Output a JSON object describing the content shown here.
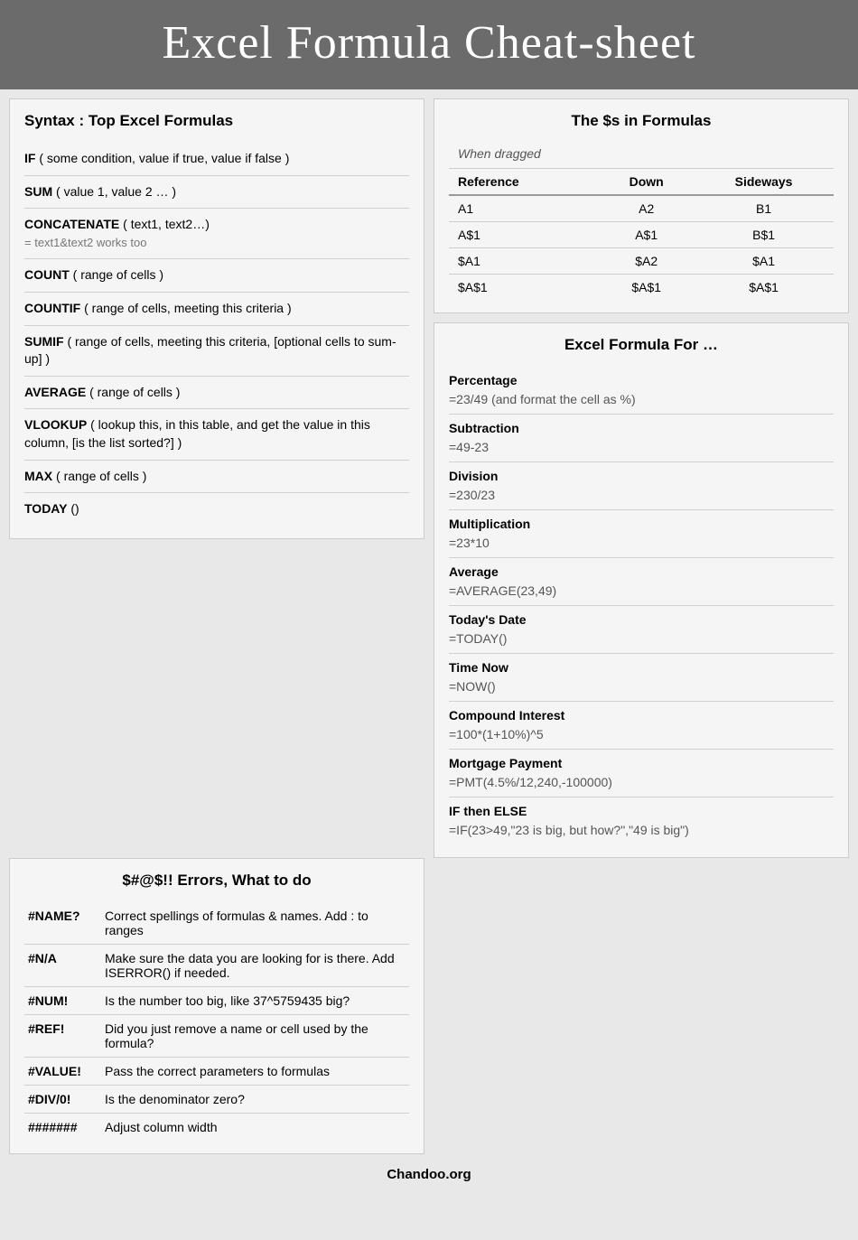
{
  "header": {
    "title": "Excel Formula Cheat-sheet"
  },
  "syntax": {
    "heading": "Syntax : Top Excel Formulas",
    "items": [
      {
        "name": "IF",
        "desc": "( some condition, value if true, value if false )",
        "sub": ""
      },
      {
        "name": "SUM",
        "desc": "( value 1, value 2 … )",
        "sub": ""
      },
      {
        "name": "CONCATENATE",
        "desc": "( text1, text2…)",
        "sub": "= text1&text2 works too"
      },
      {
        "name": "COUNT",
        "desc": "( range of cells )",
        "sub": ""
      },
      {
        "name": "COUNTIF",
        "desc": "( range of cells, meeting this criteria )",
        "sub": ""
      },
      {
        "name": "SUMIF",
        "desc": "( range of cells, meeting this criteria, [optional cells to sum-up] )",
        "sub": ""
      },
      {
        "name": "AVERAGE",
        "desc": "( range of cells )",
        "sub": ""
      },
      {
        "name": "VLOOKUP",
        "desc": "( lookup this, in this table, and get the value in this column, [is the list sorted?] )",
        "sub": ""
      },
      {
        "name": "MAX",
        "desc": "( range of cells )",
        "sub": ""
      },
      {
        "name": "TODAY",
        "desc": "()",
        "sub": ""
      }
    ]
  },
  "dollar_signs": {
    "heading": "The $s in Formulas",
    "when_dragged": "When dragged",
    "columns": [
      "Reference",
      "Down",
      "Sideways"
    ],
    "rows": [
      [
        "A1",
        "A2",
        "B1"
      ],
      [
        "A$1",
        "A$1",
        "B$1"
      ],
      [
        "$A1",
        "$A2",
        "$A1"
      ],
      [
        "$A$1",
        "$A$1",
        "$A$1"
      ]
    ]
  },
  "errors": {
    "heading": "$#@$!! Errors, What to do",
    "items": [
      {
        "code": "#NAME?",
        "desc": "Correct spellings of formulas & names. Add : to ranges"
      },
      {
        "code": "#N/A",
        "desc": "Make sure the data you are looking for is there. Add ISERROR() if needed."
      },
      {
        "code": "#NUM!",
        "desc": "Is the number too big, like 37^5759435 big?"
      },
      {
        "code": "#REF!",
        "desc": "Did you just remove a name or cell used by the formula?"
      },
      {
        "code": "#VALUE!",
        "desc": "Pass the correct parameters to formulas"
      },
      {
        "code": "#DIV/0!",
        "desc": "Is the denominator zero?"
      },
      {
        "code": "#######",
        "desc": "Adjust column width"
      }
    ]
  },
  "formula_for": {
    "heading": "Excel Formula For …",
    "items": [
      {
        "label": "Percentage",
        "value": "=23/49 (and format the cell as %)"
      },
      {
        "label": "Subtraction",
        "value": "=49-23"
      },
      {
        "label": "Division",
        "value": "=230/23"
      },
      {
        "label": "Multiplication",
        "value": "=23*10"
      },
      {
        "label": "Average",
        "value": "=AVERAGE(23,49)"
      },
      {
        "label": "Today's Date",
        "value": "=TODAY()"
      },
      {
        "label": "Time Now",
        "value": "=NOW()"
      },
      {
        "label": "Compound Interest",
        "value": "=100*(1+10%)^5"
      },
      {
        "label": "Mortgage Payment",
        "value": "=PMT(4.5%/12,240,-100000)"
      },
      {
        "label": "IF then ELSE",
        "value": "=IF(23>49,\"23 is big, but how?\",\"49 is big\")"
      }
    ]
  },
  "footer": {
    "text": "Chandoo.org"
  }
}
